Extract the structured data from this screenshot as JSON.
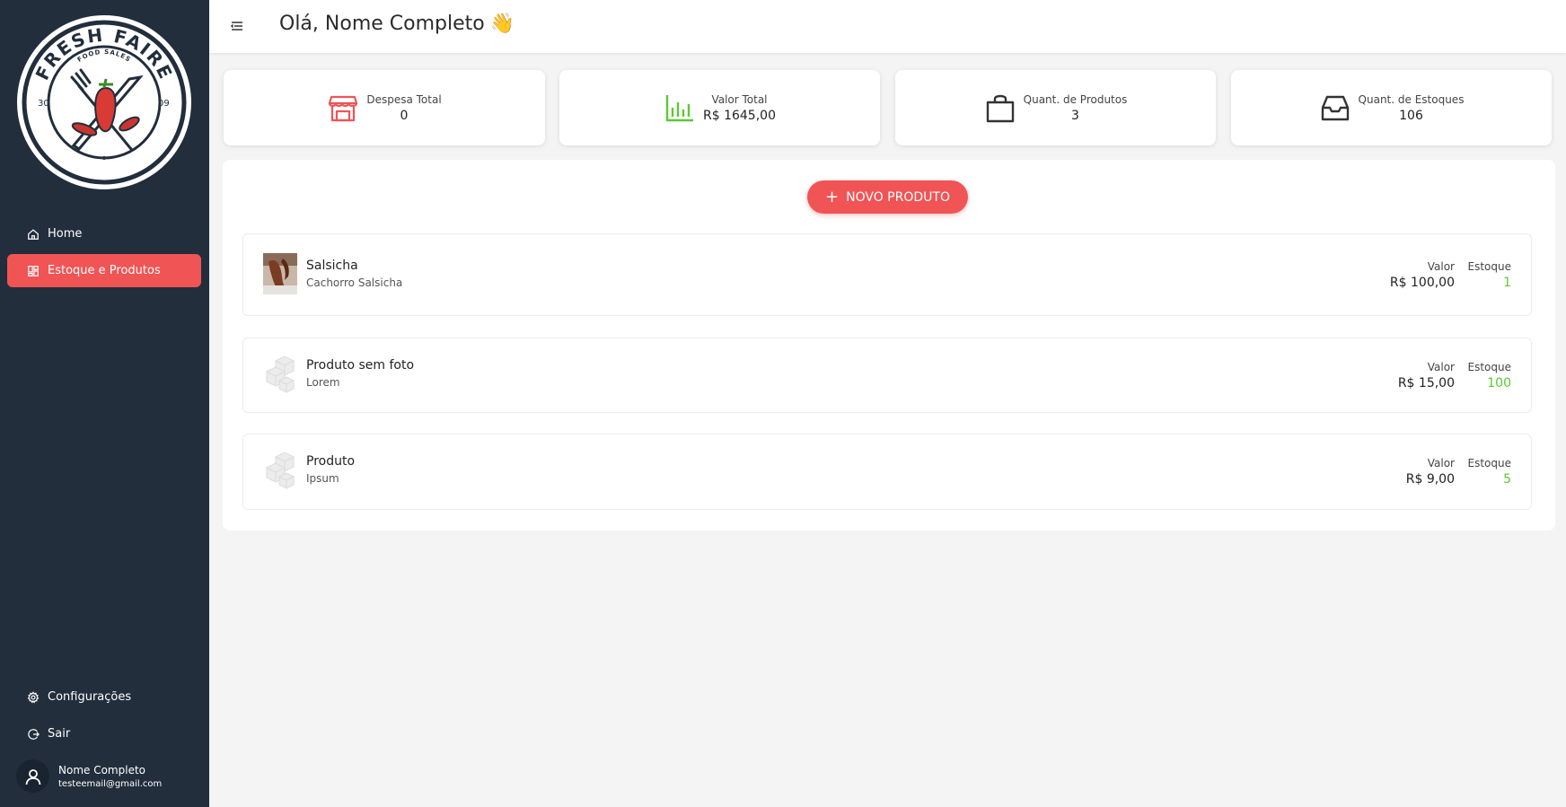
{
  "sidebar": {
    "logo": {
      "name": "FRESH FAIRE",
      "tagline": "FOOD SALES",
      "left_number": "30",
      "right_number": "09"
    },
    "nav": [
      {
        "label": "Home",
        "icon": "home-icon",
        "active": false
      },
      {
        "label": "Estoque e Produtos",
        "icon": "grid-icon",
        "active": true
      }
    ],
    "bottom": [
      {
        "label": "Configurações",
        "icon": "gear-icon"
      },
      {
        "label": "Sair",
        "icon": "logout-icon"
      }
    ],
    "user": {
      "name": "Nome Completo",
      "email": "testeemail@gmail.com",
      "icon": "user-icon"
    }
  },
  "header": {
    "greeting": "Olá, Nome Completo",
    "emoji": "👋"
  },
  "stats": [
    {
      "label": "Despesa Total",
      "value": "0",
      "icon": "store-icon",
      "color": "#f05455"
    },
    {
      "label": "Valor Total",
      "value": "R$ 1645,00",
      "icon": "bar-chart-icon",
      "color": "#5cc832"
    },
    {
      "label": "Quant. de Produtos",
      "value": "3",
      "icon": "shopping-bag-icon",
      "color": "#333333"
    },
    {
      "label": "Quant. de Estoques",
      "value": "106",
      "icon": "inbox-icon",
      "color": "#333333"
    }
  ],
  "new_product_label": "NOVO PRODUTO",
  "products": [
    {
      "name": "Salsicha",
      "description": "Cachorro Salsicha",
      "value_label": "Valor",
      "value": "R$ 100,00",
      "stock_label": "Estoque",
      "stock": "1",
      "image": "product-photo"
    },
    {
      "name": "Produto sem foto",
      "description": "Lorem",
      "value_label": "Valor",
      "value": "R$ 15,00",
      "stock_label": "Estoque",
      "stock": "100",
      "image": "placeholder-boxes-icon"
    },
    {
      "name": "Produto",
      "description": "Ipsum",
      "value_label": "Valor",
      "value": "R$ 9,00",
      "stock_label": "Estoque",
      "stock": "5",
      "image": "placeholder-boxes-icon"
    }
  ],
  "colors": {
    "sidebar": "#222e3c",
    "accent": "#f05455",
    "stock": "#5cc832"
  }
}
